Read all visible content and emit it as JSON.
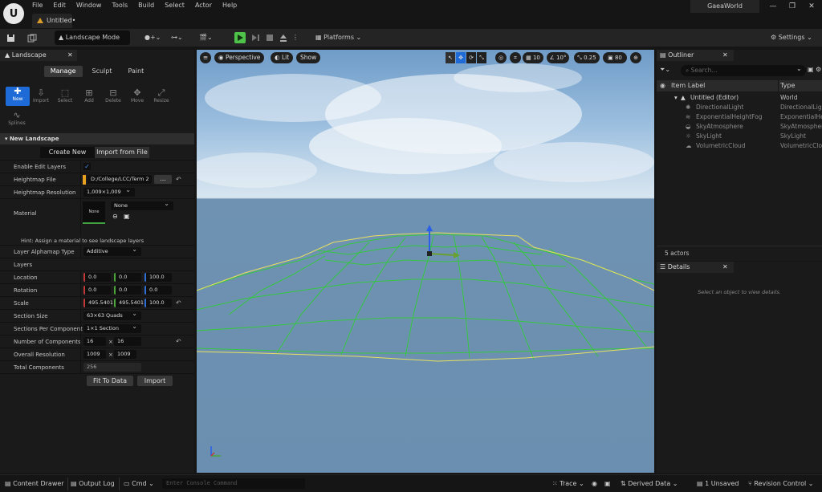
{
  "menu": [
    "File",
    "Edit",
    "Window",
    "Tools",
    "Build",
    "Select",
    "Actor",
    "Help"
  ],
  "document_tab": "Untitled•",
  "project_name": "GaeaWorld",
  "window_controls": [
    "—",
    "❐",
    "✕"
  ],
  "toolbar": {
    "mode": "Landscape Mode",
    "platforms": "Platforms",
    "settings": "Settings"
  },
  "landscape_panel": {
    "tab": "Landscape",
    "modes": [
      "Manage",
      "Sculpt",
      "Paint"
    ],
    "active_mode": "Manage",
    "tools": [
      "New",
      "Import",
      "Select",
      "Add",
      "Delete",
      "Move",
      "Resize"
    ],
    "tools2": [
      "Splines"
    ],
    "section": "New Landscape",
    "create_tabs": [
      "Create New",
      "Import from File"
    ],
    "rows": {
      "enable_edit_layers": "Enable Edit Layers",
      "heightmap_file": "Heightmap File",
      "heightmap_path": "D:/College/LCC/Term 2",
      "browse": "...",
      "heightmap_resolution": "Heightmap Resolution",
      "heightmap_resolution_value": "1,009×1,009",
      "material": "Material",
      "material_thumb": "None",
      "material_value": "None",
      "hint": "Hint: Assign a material to see landscape layers",
      "layer_alphamap_type": "Layer Alphamap Type",
      "layer_alphamap_value": "Additive",
      "layers": "Layers",
      "location": "Location",
      "location_values": [
        "0.0",
        "0.0",
        "100.0"
      ],
      "rotation": "Rotation",
      "rotation_values": [
        "0.0",
        "0.0",
        "0.0"
      ],
      "scale": "Scale",
      "scale_values": [
        "495.5401",
        "495.5401",
        "100.0"
      ],
      "section_size": "Section Size",
      "section_size_value": "63×63 Quads",
      "sections_per_component": "Sections Per Component",
      "sections_per_component_value": "1×1 Section",
      "number_of_components": "Number of Components",
      "components_values": [
        "16",
        "16"
      ],
      "overall_resolution": "Overall Resolution",
      "resolution_values": [
        "1009",
        "1009"
      ],
      "total_components": "Total Components",
      "total_components_value": "256",
      "times": "×",
      "fit_to_data": "Fit To Data",
      "import": "Import"
    }
  },
  "viewport": {
    "perspective": "Perspective",
    "lit": "Lit",
    "show": "Show",
    "grid_snap": "10",
    "rot_snap": "10°",
    "scale_snap": "0.25",
    "cam_speed": "80"
  },
  "outliner": {
    "tab": "Outliner",
    "search_placeholder": "Search...",
    "col_label": "Item Label",
    "col_type": "Type",
    "items": [
      {
        "label": "Untitled (Editor)",
        "type": "World"
      },
      {
        "label": "DirectionalLight",
        "type": "DirectionalLight"
      },
      {
        "label": "ExponentialHeightFog",
        "type": "ExponentialHeightFog"
      },
      {
        "label": "SkyAtmosphere",
        "type": "SkyAtmosphere"
      },
      {
        "label": "SkyLight",
        "type": "SkyLight"
      },
      {
        "label": "VolumetricCloud",
        "type": "VolumetricCloud"
      }
    ],
    "actor_count": "5 actors"
  },
  "details": {
    "tab": "Details",
    "empty_hint": "Select an object to view details."
  },
  "statusbar": {
    "content_drawer": "Content Drawer",
    "output_log": "Output Log",
    "cmd": "Cmd",
    "console_placeholder": "Enter Console Command",
    "trace": "Trace",
    "derived_data": "Derived Data",
    "unsaved": "1 Unsaved",
    "revision_control": "Revision Control"
  },
  "colors": {
    "accent": "#1e6ad6",
    "wireframe": "#35c840",
    "border_line": "#e8e060",
    "play": "#4fc24a"
  }
}
